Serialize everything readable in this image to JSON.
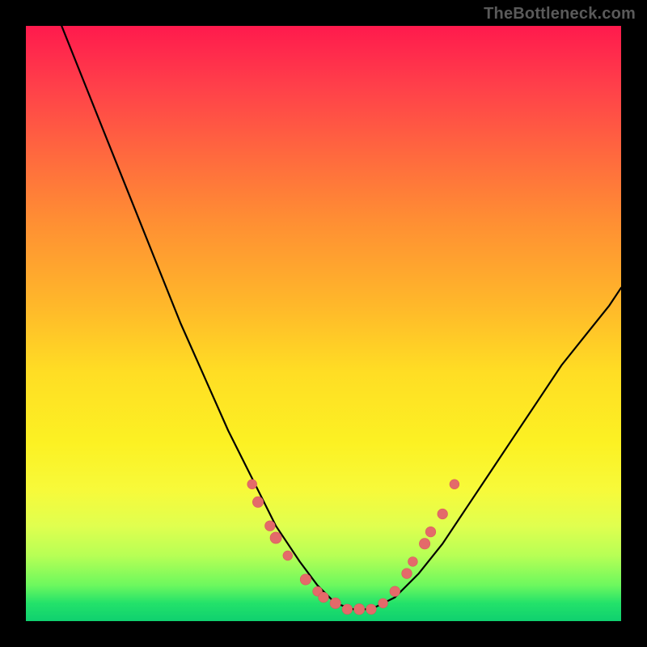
{
  "watermark": "TheBottleneck.com",
  "chart_data": {
    "type": "line",
    "title": "",
    "xlabel": "",
    "ylabel": "",
    "xlim": [
      0,
      100
    ],
    "ylim": [
      0,
      100
    ],
    "series": [
      {
        "name": "bottleneck-curve",
        "x": [
          6,
          10,
          14,
          18,
          22,
          26,
          30,
          34,
          38,
          42,
          46,
          49,
          52,
          55,
          58,
          62,
          66,
          70,
          74,
          78,
          82,
          86,
          90,
          94,
          98,
          100
        ],
        "y": [
          100,
          90,
          80,
          70,
          60,
          50,
          41,
          32,
          24,
          16,
          10,
          6,
          3,
          2,
          2,
          4,
          8,
          13,
          19,
          25,
          31,
          37,
          43,
          48,
          53,
          56
        ]
      }
    ],
    "markers": [
      {
        "x": 38,
        "y": 23,
        "r": 1.4
      },
      {
        "x": 39,
        "y": 20,
        "r": 1.6
      },
      {
        "x": 41,
        "y": 16,
        "r": 1.5
      },
      {
        "x": 42,
        "y": 14,
        "r": 1.7
      },
      {
        "x": 44,
        "y": 11,
        "r": 1.4
      },
      {
        "x": 47,
        "y": 7,
        "r": 1.6
      },
      {
        "x": 49,
        "y": 5,
        "r": 1.4
      },
      {
        "x": 50,
        "y": 4,
        "r": 1.5
      },
      {
        "x": 52,
        "y": 3,
        "r": 1.6
      },
      {
        "x": 54,
        "y": 2,
        "r": 1.5
      },
      {
        "x": 56,
        "y": 2,
        "r": 1.6
      },
      {
        "x": 58,
        "y": 2,
        "r": 1.5
      },
      {
        "x": 60,
        "y": 3,
        "r": 1.4
      },
      {
        "x": 62,
        "y": 5,
        "r": 1.5
      },
      {
        "x": 64,
        "y": 8,
        "r": 1.5
      },
      {
        "x": 65,
        "y": 10,
        "r": 1.4
      },
      {
        "x": 67,
        "y": 13,
        "r": 1.6
      },
      {
        "x": 68,
        "y": 15,
        "r": 1.5
      },
      {
        "x": 70,
        "y": 18,
        "r": 1.5
      },
      {
        "x": 72,
        "y": 23,
        "r": 1.4
      }
    ],
    "colors": {
      "curve": "#000000",
      "marker_fill": "#e46a6a",
      "marker_stroke": "#d85b5b"
    }
  }
}
